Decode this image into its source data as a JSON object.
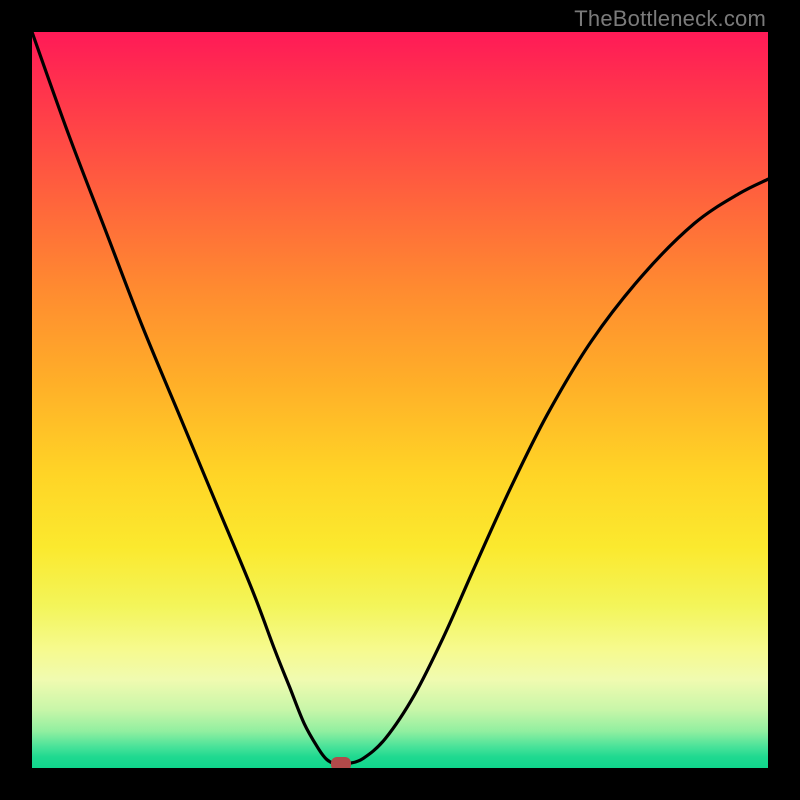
{
  "watermark": "TheBottleneck.com",
  "chart_data": {
    "type": "line",
    "title": "",
    "xlabel": "",
    "ylabel": "",
    "xlim": [
      0,
      100
    ],
    "ylim": [
      0,
      100
    ],
    "series": [
      {
        "name": "bottleneck-curve",
        "x": [
          0,
          5,
          10,
          15,
          20,
          25,
          30,
          33,
          35,
          37,
          39,
          40,
          41,
          42,
          43,
          45,
          48,
          52,
          56,
          60,
          65,
          70,
          76,
          83,
          90,
          96,
          100
        ],
        "y": [
          100,
          86,
          73,
          60,
          48,
          36,
          24,
          16,
          11,
          6,
          2.5,
          1.2,
          0.6,
          0.5,
          0.6,
          1.3,
          4,
          10,
          18,
          27,
          38,
          48,
          58,
          67,
          74,
          78,
          80
        ]
      }
    ],
    "marker": {
      "x": 42,
      "y": 0.5,
      "color": "#b24a4a"
    },
    "background_gradient": {
      "top": "#ff1a57",
      "mid": "#ffd426",
      "bottom": "#10d68c"
    }
  }
}
